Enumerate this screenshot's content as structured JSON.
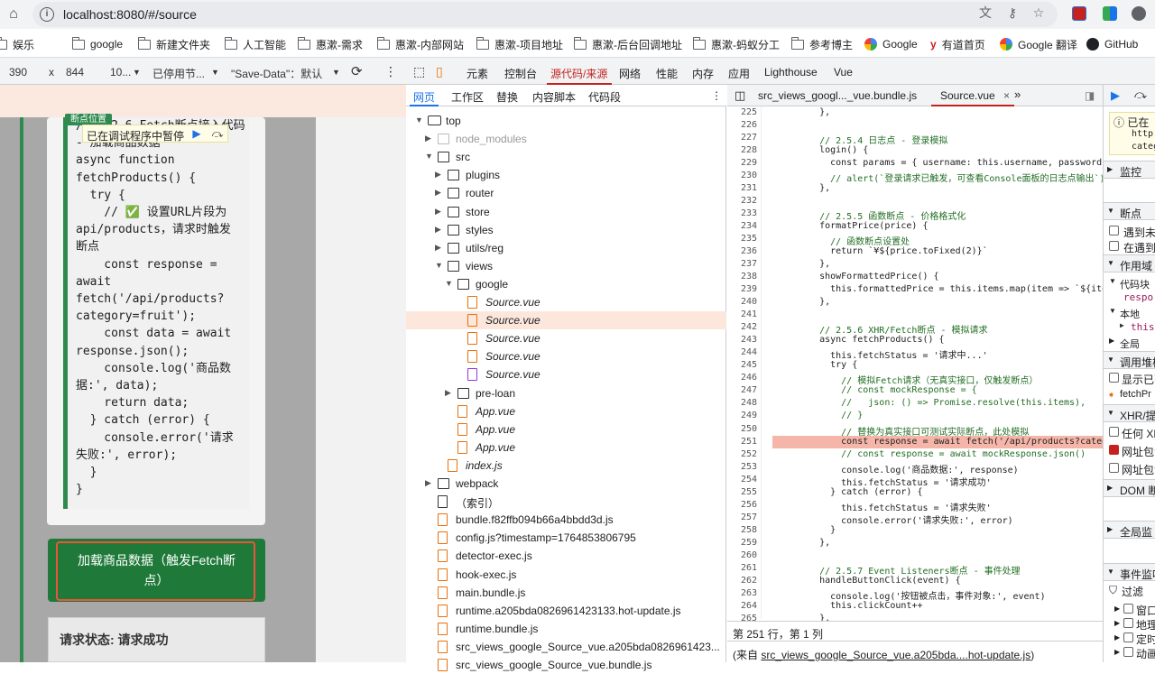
{
  "browser": {
    "url": "localhost:8080/#/source",
    "bookmarks": [
      "娱乐",
      "google",
      "新建文件夹",
      "人工智能",
      "惠漱-需求",
      "惠漱-内部网站",
      "惠漱-项目地址",
      "惠漱-后台回调地址",
      "惠漱-蚂蚁分工",
      "参考博主",
      "Google",
      "有道首页",
      "Google 翻译",
      "GitHub"
    ]
  },
  "emulation": {
    "width": "390",
    "x": "x",
    "height": "844",
    "zoom": "10...",
    "throttle": "已停用节...",
    "save_data": "\"Save-Data\"：默认"
  },
  "devtools": {
    "tabs": [
      "元素",
      "控制台",
      "源代码/来源",
      "网络",
      "性能",
      "内存",
      "应用",
      "Lighthouse",
      "Vue"
    ],
    "active_tab": "源代码/来源"
  },
  "page": {
    "bp_tag": "断点位置",
    "paused_text": "已在调试程序中暂停",
    "code_lines": [
      "// 5.2.6 Fetch断点接入代码",
      "- 加载商品数据",
      "async function",
      "fetchProducts() {",
      "  try {",
      "    // ✅ 设置URL片段为",
      "api/products，请求时触发",
      "断点",
      "    const response =",
      "await",
      "fetch('/api/products?",
      "category=fruit');",
      "    const data = await",
      "response.json();",
      "    console.log('商品数",
      "据:', data);",
      "    return data;",
      "  } catch (error) {",
      "    console.error('请求",
      "失败:', error);",
      "  }",
      "}"
    ],
    "fetch_button": "加载商品数据（触发Fetch断点）",
    "status": "请求状态: 请求成功"
  },
  "navigator": {
    "tabs": [
      "网页",
      "工作区",
      "替换",
      "内容脚本",
      "代码段"
    ],
    "tree": [
      {
        "label": "top",
        "depth": 0,
        "icon": "frame",
        "arrow": "down"
      },
      {
        "label": "node_modules",
        "depth": 1,
        "icon": "folder-dim",
        "arrow": "right"
      },
      {
        "label": "src",
        "depth": 1,
        "icon": "folder",
        "arrow": "down"
      },
      {
        "label": "plugins",
        "depth": 2,
        "icon": "folder",
        "arrow": "right"
      },
      {
        "label": "router",
        "depth": 2,
        "icon": "folder",
        "arrow": "right"
      },
      {
        "label": "store",
        "depth": 2,
        "icon": "folder",
        "arrow": "right"
      },
      {
        "label": "styles",
        "depth": 2,
        "icon": "folder",
        "arrow": "right"
      },
      {
        "label": "utils/reg",
        "depth": 2,
        "icon": "folder",
        "arrow": "right"
      },
      {
        "label": "views",
        "depth": 2,
        "icon": "folder",
        "arrow": "down"
      },
      {
        "label": "google",
        "depth": 3,
        "icon": "folder",
        "arrow": "down"
      },
      {
        "label": "Source.vue",
        "depth": 4,
        "icon": "file",
        "italic": true
      },
      {
        "label": "Source.vue",
        "depth": 4,
        "icon": "file",
        "italic": true,
        "selected": true
      },
      {
        "label": "Source.vue",
        "depth": 4,
        "icon": "file",
        "italic": true
      },
      {
        "label": "Source.vue",
        "depth": 4,
        "icon": "file",
        "italic": true
      },
      {
        "label": "Source.vue",
        "depth": 4,
        "icon": "file-vue2",
        "italic": true
      },
      {
        "label": "pre-loan",
        "depth": 3,
        "icon": "folder",
        "arrow": "right"
      },
      {
        "label": "App.vue",
        "depth": 3,
        "icon": "file",
        "italic": true
      },
      {
        "label": "App.vue",
        "depth": 3,
        "icon": "file",
        "italic": true
      },
      {
        "label": "App.vue",
        "depth": 3,
        "icon": "file",
        "italic": true
      },
      {
        "label": "index.js",
        "depth": 2,
        "icon": "file",
        "italic": true
      },
      {
        "label": "webpack",
        "depth": 1,
        "icon": "folder",
        "arrow": "right"
      },
      {
        "label": "（索引）",
        "depth": 1,
        "icon": "file-blk"
      },
      {
        "label": "bundle.f82ffb094b66a4bbdd3d.js",
        "depth": 1,
        "icon": "file"
      },
      {
        "label": "config.js?timestamp=1764853806795",
        "depth": 1,
        "icon": "file"
      },
      {
        "label": "detector-exec.js",
        "depth": 1,
        "icon": "file"
      },
      {
        "label": "hook-exec.js",
        "depth": 1,
        "icon": "file"
      },
      {
        "label": "main.bundle.js",
        "depth": 1,
        "icon": "file"
      },
      {
        "label": "runtime.a205bda0826961423133.hot-update.js",
        "depth": 1,
        "icon": "file"
      },
      {
        "label": "runtime.bundle.js",
        "depth": 1,
        "icon": "file"
      },
      {
        "label": "src_views_google_Source_vue.a205bda0826961423...",
        "depth": 1,
        "icon": "file"
      },
      {
        "label": "src_views_google_Source_vue.bundle.js",
        "depth": 1,
        "icon": "file"
      }
    ]
  },
  "editor": {
    "tabs": [
      "src_views_googl..._vue.bundle.js",
      "Source.vue"
    ],
    "active_tab": "Source.vue",
    "lines": [
      {
        "n": "225",
        "t": "    },"
      },
      {
        "n": "226",
        "t": ""
      },
      {
        "n": "227",
        "t": "    // 2.5.4 日志点 - 登录模拟"
      },
      {
        "n": "228",
        "t": "    login() {"
      },
      {
        "n": "229",
        "t": "      const params = { username: this.username, password: this."
      },
      {
        "n": "230",
        "t": "      // alert(`登录请求已触发，可查看Console面板的日志点输出`)"
      },
      {
        "n": "231",
        "t": "    },"
      },
      {
        "n": "232",
        "t": ""
      },
      {
        "n": "233",
        "t": "    // 2.5.5 函数断点 - 价格格式化"
      },
      {
        "n": "234",
        "t": "    formatPrice(price) {"
      },
      {
        "n": "235",
        "t": "      // 函数断点设置处"
      },
      {
        "n": "236",
        "t": "      return `¥${price.toFixed(2)}`"
      },
      {
        "n": "237",
        "t": "    },"
      },
      {
        "n": "238",
        "t": "    showFormattedPrice() {"
      },
      {
        "n": "239",
        "t": "      this.formattedPrice = this.items.map(item => `${item.n"
      },
      {
        "n": "240",
        "t": "    },"
      },
      {
        "n": "241",
        "t": ""
      },
      {
        "n": "242",
        "t": "    // 2.5.6 XHR/Fetch断点 - 模拟请求"
      },
      {
        "n": "243",
        "t": "    async fetchProducts() {"
      },
      {
        "n": "244",
        "t": "      this.fetchStatus = '请求中...'"
      },
      {
        "n": "245",
        "t": "      try {"
      },
      {
        "n": "246",
        "t": "        // 模拟Fetch请求（无真实接口，仅触发断点）"
      },
      {
        "n": "247",
        "t": "        // const mockResponse = {"
      },
      {
        "n": "248",
        "t": "        //   json: () => Promise.resolve(this.items),"
      },
      {
        "n": "249",
        "t": "        // }"
      },
      {
        "n": "250",
        "t": "        // 替换为真实接口可测试实际断点，此处模拟"
      },
      {
        "n": "251",
        "t": "        const response = await fetch('/api/products?category",
        "bp": true
      },
      {
        "n": "252",
        "t": "        // const response = await mockResponse.json()"
      },
      {
        "n": "253",
        "t": "        console.log('商品数据:', response)"
      },
      {
        "n": "254",
        "t": "        this.fetchStatus = '请求成功'"
      },
      {
        "n": "255",
        "t": "      } catch (error) {"
      },
      {
        "n": "256",
        "t": "        this.fetchStatus = '请求失败'"
      },
      {
        "n": "257",
        "t": "        console.error('请求失败:', error)"
      },
      {
        "n": "258",
        "t": "      }"
      },
      {
        "n": "259",
        "t": "    },"
      },
      {
        "n": "260",
        "t": ""
      },
      {
        "n": "261",
        "t": "    // 2.5.7 Event Listeners断点 - 事件处理"
      },
      {
        "n": "262",
        "t": "    handleButtonClick(event) {"
      },
      {
        "n": "263",
        "t": "      console.log('按钮被点击，事件对象:', event)"
      },
      {
        "n": "264",
        "t": "      this.clickCount++"
      },
      {
        "n": "265",
        "t": "    },"
      }
    ],
    "status": "第 251 行，第 1 列",
    "source_prefix": "(来自 ",
    "source_link": "src_views_google_Source_vue.a205bda....hot-update.js",
    "source_suffix": ")"
  },
  "sidebar": {
    "paused_title": "已在",
    "paused_l1": "http:",
    "paused_l2": "categ",
    "watch": "监控",
    "breakpoints": "断点",
    "bp_opt1": "遇到未",
    "bp_opt2": "在遇到",
    "scope": "作用域",
    "block": "代码块",
    "resp": "respo",
    "local": "本地",
    "this": "this:",
    "global": "全局",
    "callstack": "调用堆栈",
    "show_ignored": "显示已列",
    "frame": "fetchPr",
    "xhr": "XHR/提",
    "any_xhr": "任何 XH",
    "url_contains": "网址包含",
    "url_contains2": "网址包含",
    "dom": "DOM 断",
    "global_listeners": "全局监",
    "event_listeners": "事件监听",
    "filter": "过滤",
    "ev1": "窗口",
    "ev2": "地理",
    "ev3": "定时",
    "ev4": "动画"
  },
  "colors": {
    "accent": "#c5221f",
    "green": "#1f7a3a",
    "breakpoint": "#f5b5a8"
  }
}
